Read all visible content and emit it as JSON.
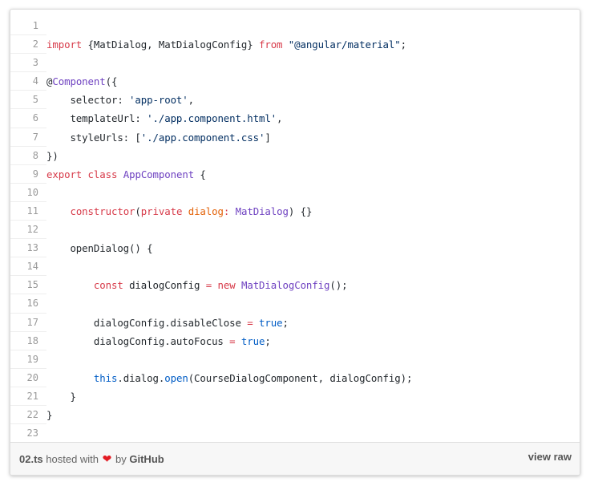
{
  "gist": {
    "lines": [
      {
        "n": "1",
        "tokens": []
      },
      {
        "n": "2",
        "tokens": [
          [
            "k",
            "import"
          ],
          [
            "t",
            " {MatDialog, MatDialogConfig} "
          ],
          [
            "k",
            "from"
          ],
          [
            "t",
            " "
          ],
          [
            "s",
            "\"@angular/material\""
          ],
          [
            "t",
            ";"
          ]
        ]
      },
      {
        "n": "3",
        "tokens": []
      },
      {
        "n": "4",
        "tokens": [
          [
            "t",
            "@"
          ],
          [
            "e",
            "Component"
          ],
          [
            "t",
            "({"
          ]
        ]
      },
      {
        "n": "5",
        "tokens": [
          [
            "t",
            "    selector: "
          ],
          [
            "s",
            "'app-root'"
          ],
          [
            "t",
            ","
          ]
        ]
      },
      {
        "n": "6",
        "tokens": [
          [
            "t",
            "    templateUrl: "
          ],
          [
            "s",
            "'./app.component.html'"
          ],
          [
            "t",
            ","
          ]
        ]
      },
      {
        "n": "7",
        "tokens": [
          [
            "t",
            "    styleUrls: ["
          ],
          [
            "s",
            "'./app.component.css'"
          ],
          [
            "t",
            "]"
          ]
        ]
      },
      {
        "n": "8",
        "tokens": [
          [
            "t",
            "})"
          ]
        ]
      },
      {
        "n": "9",
        "tokens": [
          [
            "k",
            "export"
          ],
          [
            "t",
            " "
          ],
          [
            "k",
            "class"
          ],
          [
            "t",
            " "
          ],
          [
            "e",
            "AppComponent"
          ],
          [
            "t",
            " {"
          ]
        ]
      },
      {
        "n": "10",
        "tokens": []
      },
      {
        "n": "11",
        "tokens": [
          [
            "t",
            "    "
          ],
          [
            "k",
            "constructor"
          ],
          [
            "t",
            "("
          ],
          [
            "k",
            "private"
          ],
          [
            "t",
            " "
          ],
          [
            "v",
            "dialog"
          ],
          [
            "k",
            ":"
          ],
          [
            "t",
            " "
          ],
          [
            "e",
            "MatDialog"
          ],
          [
            "t",
            ") {}"
          ]
        ]
      },
      {
        "n": "12",
        "tokens": []
      },
      {
        "n": "13",
        "tokens": [
          [
            "t",
            "    openDialog() {"
          ]
        ]
      },
      {
        "n": "14",
        "tokens": []
      },
      {
        "n": "15",
        "tokens": [
          [
            "t",
            "        "
          ],
          [
            "k",
            "const"
          ],
          [
            "t",
            " dialogConfig "
          ],
          [
            "k",
            "="
          ],
          [
            "t",
            " "
          ],
          [
            "k",
            "new"
          ],
          [
            "t",
            " "
          ],
          [
            "e",
            "MatDialogConfig"
          ],
          [
            "t",
            "();"
          ]
        ]
      },
      {
        "n": "16",
        "tokens": []
      },
      {
        "n": "17",
        "tokens": [
          [
            "t",
            "        dialogConfig.disableClose "
          ],
          [
            "k",
            "="
          ],
          [
            "t",
            " "
          ],
          [
            "c1",
            "true"
          ],
          [
            "t",
            ";"
          ]
        ]
      },
      {
        "n": "18",
        "tokens": [
          [
            "t",
            "        dialogConfig.autoFocus "
          ],
          [
            "k",
            "="
          ],
          [
            "t",
            " "
          ],
          [
            "c1",
            "true"
          ],
          [
            "t",
            ";"
          ]
        ]
      },
      {
        "n": "19",
        "tokens": []
      },
      {
        "n": "20",
        "tokens": [
          [
            "t",
            "        "
          ],
          [
            "c1",
            "this"
          ],
          [
            "t",
            ".dialog."
          ],
          [
            "c1",
            "open"
          ],
          [
            "t",
            "(CourseDialogComponent, dialogConfig);"
          ]
        ]
      },
      {
        "n": "21",
        "tokens": [
          [
            "t",
            "    }"
          ]
        ]
      },
      {
        "n": "22",
        "tokens": [
          [
            "t",
            "}"
          ]
        ]
      },
      {
        "n": "23",
        "tokens": []
      }
    ],
    "footer": {
      "filename": "02.ts",
      "hosted_with": "hosted with",
      "heart": "❤",
      "by": "by",
      "brand": "GitHub",
      "view_raw": "view raw"
    }
  }
}
